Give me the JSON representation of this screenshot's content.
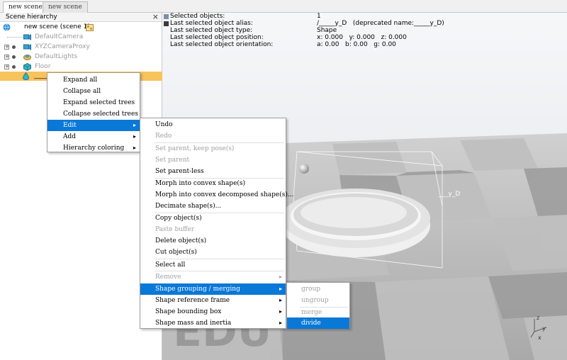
{
  "tabs": [
    {
      "label": "new scene",
      "active": true
    },
    {
      "label": "new scene",
      "active": false
    }
  ],
  "hierarchy": {
    "title": "Scene hierarchy",
    "close_glyph": "×",
    "scene_label": "new scene (scene 1)",
    "items": [
      {
        "label": "DefaultCamera",
        "icon": "camera-icon"
      },
      {
        "label": "XYZCameraProxy",
        "icon": "camera-icon"
      },
      {
        "label": "DefaultLights",
        "icon": "light-icon"
      },
      {
        "label": "Floor",
        "icon": "cube-icon"
      },
      {
        "label": "_____",
        "icon": "shape-icon",
        "selected": true
      }
    ]
  },
  "info": {
    "rows": [
      {
        "key": "Selected objects:",
        "value": "1"
      },
      {
        "key": "Last selected object alias:",
        "value": "/_____y_D   (deprecated name:_____y_D)"
      },
      {
        "key": "Last selected object type:",
        "value": "Shape"
      },
      {
        "key": "Last selected object position:",
        "value": "x: 0.000   y: 0.000   z: 0.000"
      },
      {
        "key": "Last selected object orientation:",
        "value": "a: 0.00   b: 0.00   g: 0.00"
      }
    ]
  },
  "scene": {
    "object_label": "___y_D",
    "axis_z": "z",
    "axis_y": "y",
    "axis_x": "x",
    "watermark": "EDU"
  },
  "menu1": {
    "items": [
      {
        "label": "Expand all"
      },
      {
        "label": "Collapse all"
      },
      {
        "label": "Expand selected trees"
      },
      {
        "label": "Collapse selected trees"
      },
      {
        "label": "Edit",
        "submenu": true,
        "highlighted": true
      },
      {
        "label": "Add",
        "submenu": true
      },
      {
        "label": "Hierarchy coloring",
        "submenu": true
      }
    ]
  },
  "menu2": {
    "items": [
      {
        "label": "Undo"
      },
      {
        "label": "Redo",
        "disabled": true
      },
      {
        "label": "Set parent, keep pose(s)",
        "disabled": true
      },
      {
        "label": "Set parent",
        "disabled": true
      },
      {
        "label": "Set parent-less"
      },
      {
        "label": "Morph into convex shape(s)"
      },
      {
        "label": "Morph into convex decomposed shape(s)..."
      },
      {
        "label": "Decimate shape(s)..."
      },
      {
        "label": "Copy object(s)"
      },
      {
        "label": "Paste buffer",
        "disabled": true
      },
      {
        "label": "Delete object(s)"
      },
      {
        "label": "Cut object(s)"
      },
      {
        "label": "Select all"
      },
      {
        "label": "Remove",
        "disabled": true,
        "submenu": true
      },
      {
        "label": "Shape grouping / merging",
        "submenu": true,
        "highlighted": true
      },
      {
        "label": "Shape reference frame",
        "submenu": true
      },
      {
        "label": "Shape bounding box",
        "submenu": true
      },
      {
        "label": "Shape mass and inertia",
        "submenu": true
      }
    ]
  },
  "menu3": {
    "items": [
      {
        "label": "group",
        "disabled": true
      },
      {
        "label": "ungroup",
        "disabled": true
      },
      {
        "label": "merge",
        "disabled": true
      },
      {
        "label": "divide",
        "highlighted": true
      }
    ]
  },
  "colors": {
    "highlight": "#0a78d7",
    "selection": "#f7c35d"
  }
}
